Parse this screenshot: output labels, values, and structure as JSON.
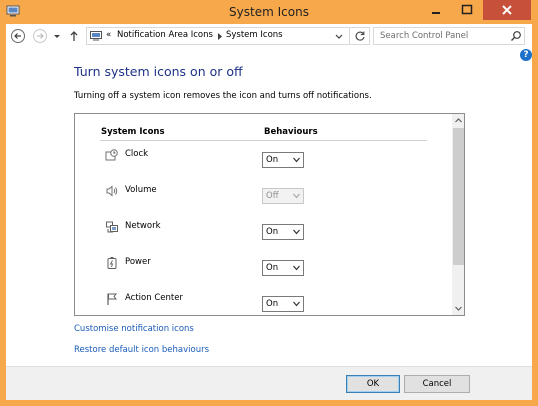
{
  "window": {
    "title": "System Icons",
    "accent": "#f7a84a",
    "close_color": "#c7503a"
  },
  "nav": {
    "breadcrumb_overflow": "«",
    "crumbs": [
      "Notification Area Icons",
      "System Icons"
    ],
    "search_placeholder": "Search Control Panel",
    "help_label": "?"
  },
  "page": {
    "heading": "Turn system icons on or off",
    "description": "Turning off a system icon removes the icon and turns off notifications.",
    "heading_color": "#1e3287"
  },
  "table": {
    "col_icons": "System Icons",
    "col_behaviours": "Behaviours",
    "rows": [
      {
        "name": "Clock",
        "value": "On",
        "enabled": true,
        "icon": "clock-icon"
      },
      {
        "name": "Volume",
        "value": "Off",
        "enabled": false,
        "icon": "volume-icon"
      },
      {
        "name": "Network",
        "value": "On",
        "enabled": true,
        "icon": "network-icon"
      },
      {
        "name": "Power",
        "value": "On",
        "enabled": true,
        "icon": "power-icon"
      },
      {
        "name": "Action Center",
        "value": "On",
        "enabled": true,
        "icon": "action-center-flag-icon"
      }
    ]
  },
  "links": {
    "customise": "Customise notification icons",
    "restore": "Restore default icon behaviours",
    "color": "#1a5bb8"
  },
  "footer": {
    "ok": "OK",
    "cancel": "Cancel"
  }
}
